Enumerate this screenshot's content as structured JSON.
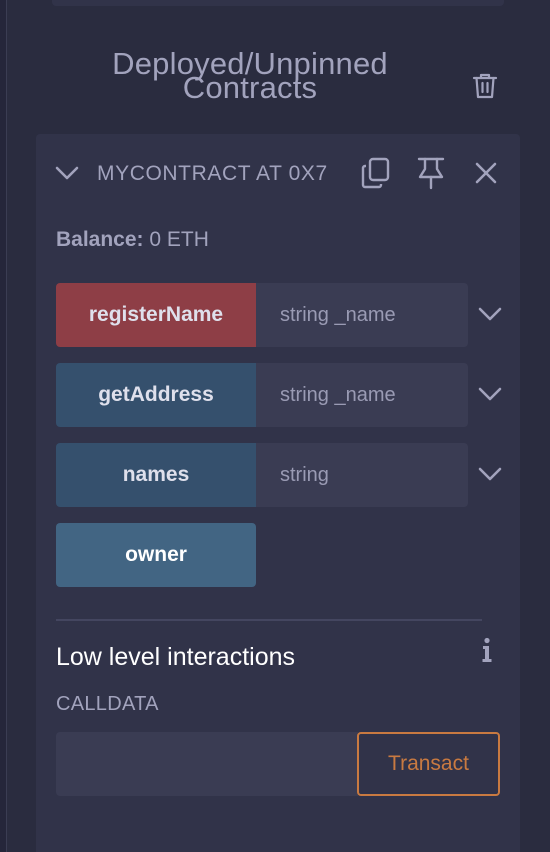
{
  "section": {
    "title_line1": "Deployed/Unpinned",
    "title_line2": "Contracts",
    "trash_icon": "trash-icon"
  },
  "contract": {
    "name": "MYCONTRACT AT 0X7",
    "collapse_icon": "chevron-down-icon",
    "actions": [
      "copy-icon",
      "pin-icon",
      "close-icon"
    ],
    "balance_label": "Balance:",
    "balance_value": "0 ETH"
  },
  "functions": [
    {
      "label": "registerName",
      "placeholder": "string _name",
      "kind": "payable",
      "expandable": true
    },
    {
      "label": "getAddress",
      "placeholder": "string _name",
      "kind": "view",
      "expandable": true
    },
    {
      "label": "names",
      "placeholder": "string",
      "kind": "view",
      "expandable": true
    },
    {
      "label": "owner",
      "placeholder": "",
      "kind": "view",
      "expandable": false
    }
  ],
  "low_level": {
    "title": "Low level interactions",
    "info_icon": "info-icon",
    "calldata_label": "CALLDATA",
    "calldata_value": "",
    "transact_label": "Transact"
  },
  "colors": {
    "background": "#2a2c3f",
    "card": "#313349",
    "text_muted": "#a2a3bd",
    "payable_button": "#8e3e46",
    "view_button": "#35506d",
    "transact_accent": "#c97a41"
  }
}
